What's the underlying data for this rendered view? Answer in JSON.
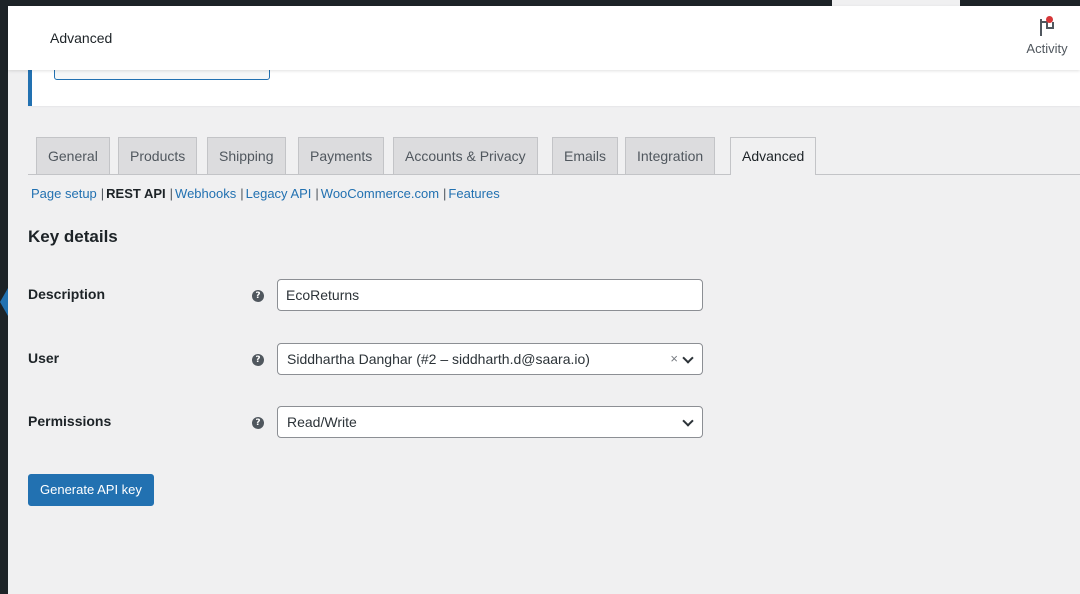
{
  "header": {
    "title": "Advanced",
    "activity_label": "Activity"
  },
  "tabs": [
    {
      "label": "General"
    },
    {
      "label": "Products"
    },
    {
      "label": "Shipping"
    },
    {
      "label": "Payments"
    },
    {
      "label": "Accounts & Privacy"
    },
    {
      "label": "Emails"
    },
    {
      "label": "Integration"
    },
    {
      "label": "Advanced",
      "active": true
    }
  ],
  "sublinks": [
    {
      "label": "Page setup"
    },
    {
      "label": "REST API",
      "current": true
    },
    {
      "label": "Webhooks"
    },
    {
      "label": "Legacy API"
    },
    {
      "label": "WooCommerce.com"
    },
    {
      "label": "Features"
    }
  ],
  "form": {
    "section_title": "Key details",
    "description": {
      "label": "Description",
      "value": "EcoReturns"
    },
    "user": {
      "label": "User",
      "value": "Siddhartha Danghar (#2 – siddharth.d@saara.io)",
      "clear_symbol": "×"
    },
    "permissions": {
      "label": "Permissions",
      "value": "Read/Write"
    },
    "help_symbol": "?",
    "submit_label": "Generate API key"
  },
  "colors": {
    "accent": "#2271b1",
    "notification_dot": "#d63638",
    "admin_bar": "#1d2327"
  }
}
